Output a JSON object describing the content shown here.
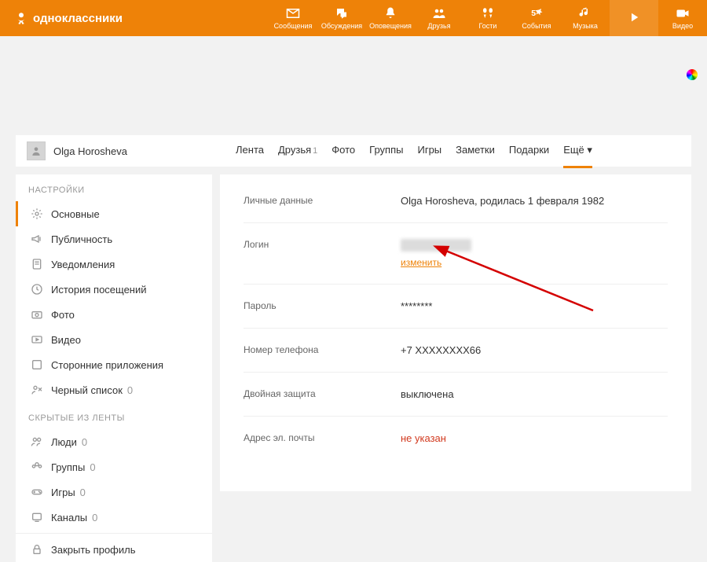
{
  "brand": "одноклассники",
  "topnav": [
    {
      "label": "Сообщения",
      "icon": "mail"
    },
    {
      "label": "Обсуждения",
      "icon": "chat"
    },
    {
      "label": "Оповещения",
      "icon": "bell"
    },
    {
      "label": "Друзья",
      "icon": "friends"
    },
    {
      "label": "Гости",
      "icon": "guests"
    },
    {
      "label": "События",
      "icon": "events"
    },
    {
      "label": "Музыка",
      "icon": "music"
    },
    {
      "label": "",
      "icon": "video-rec"
    },
    {
      "label": "Видео",
      "icon": "video"
    }
  ],
  "user": {
    "name": "Olga Horosheva"
  },
  "tabs": [
    {
      "label": "Лента"
    },
    {
      "label": "Друзья",
      "count": "1"
    },
    {
      "label": "Фото"
    },
    {
      "label": "Группы"
    },
    {
      "label": "Игры"
    },
    {
      "label": "Заметки"
    },
    {
      "label": "Подарки"
    },
    {
      "label": "Ещё ▾",
      "active": true
    }
  ],
  "sidebar": {
    "settings_title": "НАСТРОЙКИ",
    "items": [
      {
        "label": "Основные",
        "icon": "gear",
        "active": true
      },
      {
        "label": "Публичность",
        "icon": "megaphone"
      },
      {
        "label": "Уведомления",
        "icon": "note"
      },
      {
        "label": "История посещений",
        "icon": "history"
      },
      {
        "label": "Фото",
        "icon": "camera"
      },
      {
        "label": "Видео",
        "icon": "video"
      },
      {
        "label": "Сторонние приложения",
        "icon": "app"
      },
      {
        "label": "Черный список",
        "count": "0",
        "icon": "blacklist"
      }
    ],
    "hidden_title": "СКРЫТЫЕ ИЗ ЛЕНТЫ",
    "hidden": [
      {
        "label": "Люди",
        "count": "0",
        "icon": "people"
      },
      {
        "label": "Группы",
        "count": "0",
        "icon": "groups"
      },
      {
        "label": "Игры",
        "count": "0",
        "icon": "games"
      },
      {
        "label": "Каналы",
        "count": "0",
        "icon": "channels"
      }
    ],
    "lock": {
      "label": "Закрыть профиль",
      "icon": "lock"
    }
  },
  "settings": {
    "personal": {
      "label": "Личные данные",
      "value": "Olga Horosheva, родилась 1 февраля 1982"
    },
    "login": {
      "label": "Логин",
      "change": "изменить"
    },
    "password": {
      "label": "Пароль",
      "value": "********"
    },
    "phone": {
      "label": "Номер телефона",
      "value": "+7 XXXXXXXX66"
    },
    "twofa": {
      "label": "Двойная защита",
      "value": "выключена"
    },
    "email": {
      "label": "Адрес эл. почты",
      "value": "не указан"
    }
  }
}
